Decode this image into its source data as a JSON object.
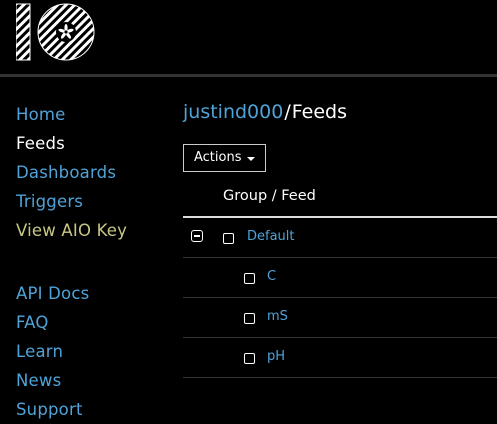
{
  "colors": {
    "link": "#4fa3d8",
    "active": "#ffffff",
    "key_link": "#c9c785",
    "background": "#000000"
  },
  "logo": {
    "icon": "io-logo-icon"
  },
  "sidebar": {
    "items": [
      {
        "label": "Home",
        "state": "link"
      },
      {
        "label": "Feeds",
        "state": "active"
      },
      {
        "label": "Dashboards",
        "state": "link"
      },
      {
        "label": "Triggers",
        "state": "link"
      },
      {
        "label": "View AIO Key",
        "state": "key"
      }
    ],
    "items2": [
      {
        "label": "API Docs"
      },
      {
        "label": "FAQ"
      },
      {
        "label": "Learn"
      },
      {
        "label": "News"
      },
      {
        "label": "Support"
      }
    ]
  },
  "breadcrumb": {
    "user": "justind000",
    "separator": "/",
    "page": "Feeds"
  },
  "toolbar": {
    "actions_label": "Actions"
  },
  "table": {
    "header": "Group / Feed",
    "group": {
      "name": "Default"
    },
    "feeds": [
      {
        "name": "C"
      },
      {
        "name": "mS"
      },
      {
        "name": "pH"
      }
    ]
  }
}
